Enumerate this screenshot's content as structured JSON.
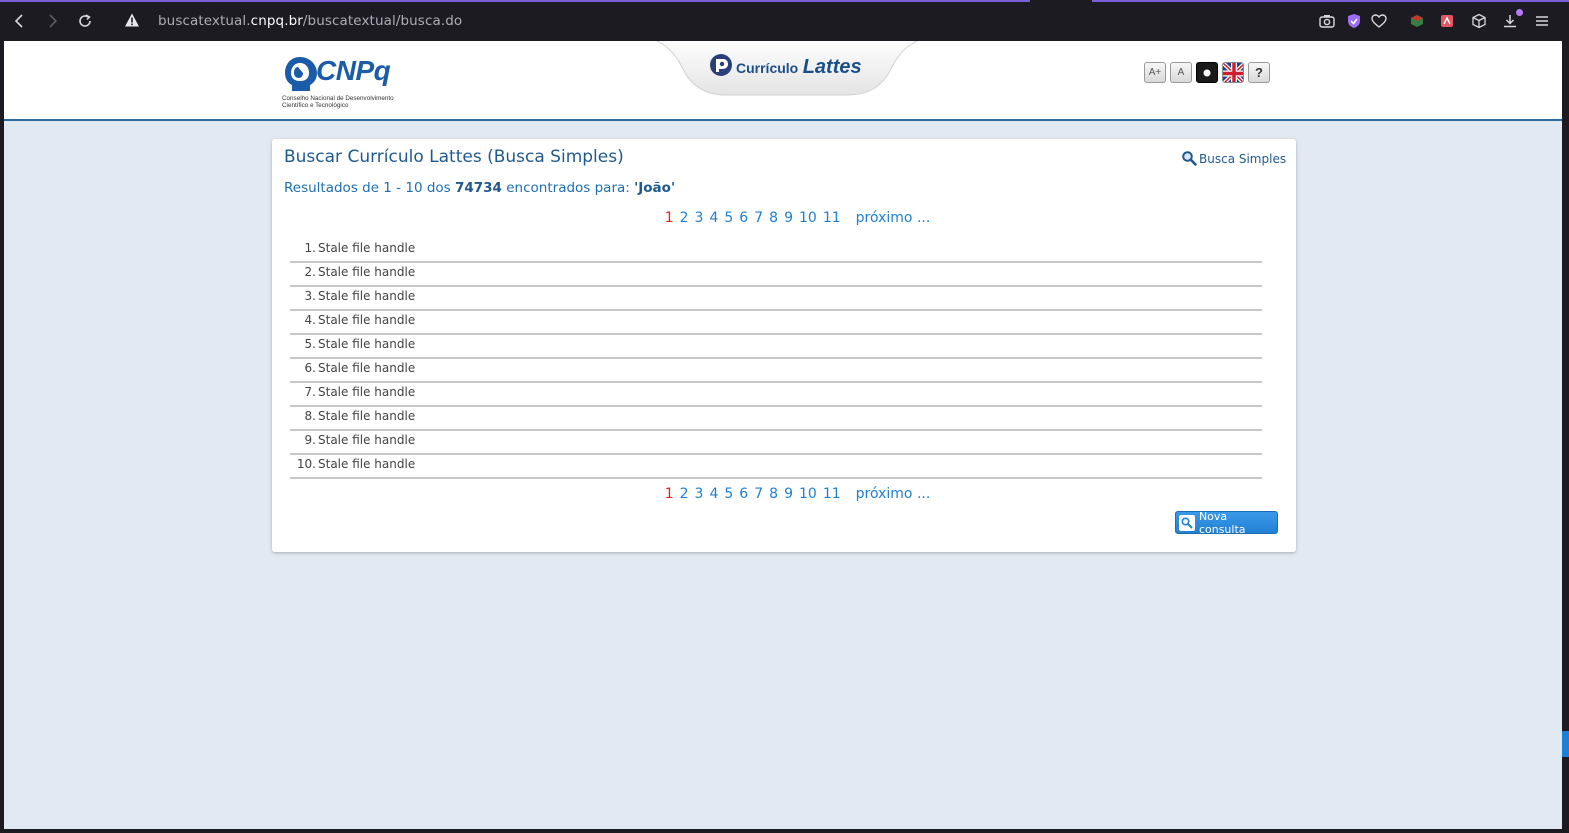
{
  "browser": {
    "url_prefix": "buscatextual.",
    "url_domain": "cnpq.br",
    "url_path": "/buscatextual/busca.do"
  },
  "header": {
    "logo_text": "CNPq",
    "logo_subtitle_1": "Conselho Nacional de Desenvolvimento",
    "logo_subtitle_2": "Científico e Tecnológico",
    "app_small": "Currículo",
    "app_big": "Lattes",
    "btn_increase_font": "A+",
    "btn_normal_font": "A",
    "btn_help": "?"
  },
  "card": {
    "title": "Buscar Currículo Lattes (Busca Simples)",
    "busca_link": "Busca Simples",
    "results_prefix": "Resultados de 1 - 10 dos ",
    "results_count": "74734",
    "results_middle": " encontrados para: ",
    "results_query": "'João'",
    "pages": [
      "1",
      "2",
      "3",
      "4",
      "5",
      "6",
      "7",
      "8",
      "9",
      "10",
      "11"
    ],
    "next_label": "próximo ...",
    "results": [
      {
        "num": "1.",
        "text": "Stale file handle"
      },
      {
        "num": "2.",
        "text": "Stale file handle"
      },
      {
        "num": "3.",
        "text": "Stale file handle"
      },
      {
        "num": "4.",
        "text": "Stale file handle"
      },
      {
        "num": "5.",
        "text": "Stale file handle"
      },
      {
        "num": "6.",
        "text": "Stale file handle"
      },
      {
        "num": "7.",
        "text": "Stale file handle"
      },
      {
        "num": "8.",
        "text": "Stale file handle"
      },
      {
        "num": "9.",
        "text": "Stale file handle"
      },
      {
        "num": "10.",
        "text": "Stale file handle"
      }
    ],
    "nova_consulta": "Nova consulta"
  },
  "colors": {
    "accent": "#1f5a8f",
    "link": "#1f7fd0",
    "current_page": "#e02424",
    "page_bg": "#e1e9f2"
  }
}
